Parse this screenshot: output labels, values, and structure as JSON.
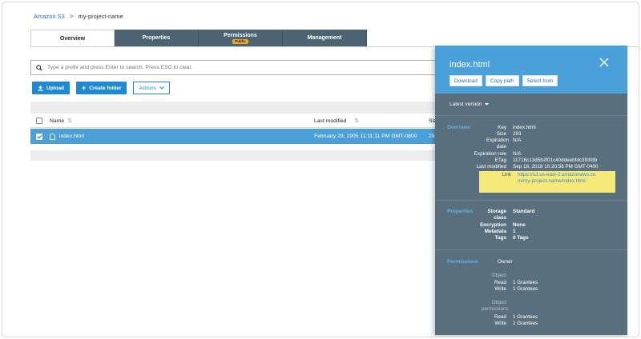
{
  "breadcrumb": {
    "root": "Amazon S3",
    "separator": ">",
    "current": "my-project-name"
  },
  "tabs": [
    {
      "label": "Overview",
      "active": true,
      "badge": ""
    },
    {
      "label": "Properties",
      "active": false,
      "badge": ""
    },
    {
      "label": "Permissions",
      "active": false,
      "badge": "Public"
    },
    {
      "label": "Management",
      "active": false,
      "badge": ""
    }
  ],
  "search": {
    "placeholder": "Type a prefix and press Enter to search. Press ESC to clear."
  },
  "actions": {
    "upload": "Upload",
    "create_folder": "Create folder",
    "actions": "Actions"
  },
  "table": {
    "columns": {
      "name": "Name",
      "last_modified": "Last modified",
      "size": "Siz"
    },
    "rows": [
      {
        "name": "index.html",
        "last_modified": "February 29, 1905 11:11:11 PM GMT-0800",
        "size": "29"
      }
    ]
  },
  "panel": {
    "title": "index.html",
    "buttons": {
      "download": "Download",
      "copy_path": "Copy path",
      "select_from": "Select from"
    },
    "version": "Latest version",
    "overview": {
      "label": "Overview",
      "key": {
        "k": "Key",
        "v": "index.html"
      },
      "size": {
        "k": "Size",
        "v": "293"
      },
      "expiration_date": {
        "k": "Expiration date",
        "v": "N/A"
      },
      "expiration_rule": {
        "k": "Expiration rule",
        "v": "N/A"
      },
      "etag": {
        "k": "ETag",
        "v": "11716c13d5b2f01c40ddeebfdc393fdb"
      },
      "last_modified": {
        "k": "Last modified",
        "v": "Sep 18, 2018 10:20:56 PM GMT-0400"
      },
      "link": {
        "k": "Link",
        "v": "https://s3.us-east-2.amazonaws.com/my-project-name/index.html"
      }
    },
    "properties": {
      "label": "Properties",
      "storage_class": {
        "k": "Storage class",
        "v": "Standard"
      },
      "encryption": {
        "k": "Encryption",
        "v": "None"
      },
      "metadata": {
        "k": "Metadata",
        "v": "1"
      },
      "tags": {
        "k": "Tags",
        "v": "0 Tags"
      }
    },
    "permissions": {
      "label": "Permissions",
      "owner": "Owner",
      "object": "Object",
      "object_read": {
        "k": "Read",
        "v": "1 Grantees"
      },
      "object_write": {
        "k": "Write",
        "v": "1 Grantees"
      },
      "object_permissions": "Object permissions",
      "perm_read": {
        "k": "Read",
        "v": "1 Grantees"
      },
      "perm_write": {
        "k": "Write",
        "v": "1 Grantees"
      }
    }
  },
  "colors": {
    "accent": "#1f8ad1",
    "selected_row": "#4ba0d8",
    "tab_dark": "#4c6472",
    "panel_bg": "#5a6f7d",
    "link_highlight": "#f5e97a",
    "badge": "#f2a623"
  },
  "icons": [
    "search-icon",
    "upload-icon",
    "plus-icon",
    "chevron-down-icon",
    "sort-icon",
    "file-icon",
    "close-icon",
    "caret-down-icon"
  ]
}
